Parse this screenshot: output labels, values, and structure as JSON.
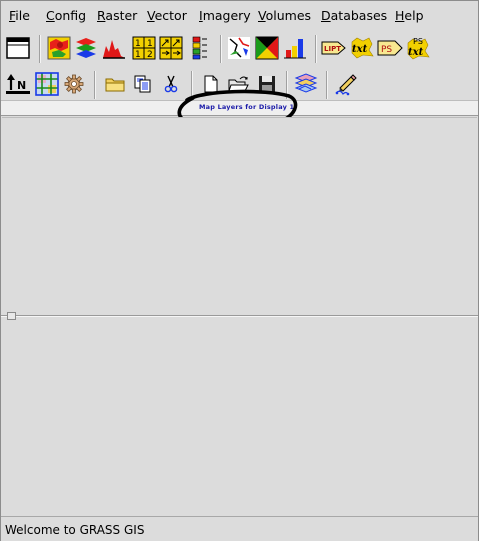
{
  "menu": {
    "items": [
      {
        "mnemonic": "F",
        "rest": "ile"
      },
      {
        "mnemonic": "C",
        "rest": "onfig"
      },
      {
        "mnemonic": "R",
        "rest": "aster"
      },
      {
        "mnemonic": "V",
        "rest": "ector"
      },
      {
        "mnemonic": "I",
        "rest": "magery"
      },
      {
        "mnemonic": "V",
        "rest": "olumes"
      },
      {
        "mnemonic": "D",
        "rest": "atabases"
      },
      {
        "mnemonic": "H",
        "rest": "elp"
      }
    ]
  },
  "toolbar1": {
    "icons": [
      "display-window-icon",
      "raster-map-icon",
      "rgb-layers-icon",
      "histogram-icon",
      "raster-map-calculator-icon",
      "raster-arrows-icon",
      "legend-icon",
      "vector-map-icon",
      "thematic-map-icon",
      "bar-chart-icon",
      "label-text-icon",
      "text-icon",
      "postscript-icon",
      "postscript-text-icon"
    ]
  },
  "toolbar2": {
    "icons": [
      "north-arrow-icon",
      "grid-icon",
      "gear-icon",
      "folder-icon",
      "copy-icon",
      "scissors-icon",
      "new-file-icon",
      "open-file-icon",
      "save-icon",
      "layer-stack-icon",
      "digitize-pencil-icon"
    ],
    "north_label": "N"
  },
  "tabs": [
    {
      "label": "Map Layers for Display 1"
    }
  ],
  "colors": {
    "annotation": "#000000",
    "tab_text": "#1a1aa8",
    "panel": "#dcdcdc"
  },
  "statusbar": {
    "text": "Welcome to GRASS GIS"
  }
}
